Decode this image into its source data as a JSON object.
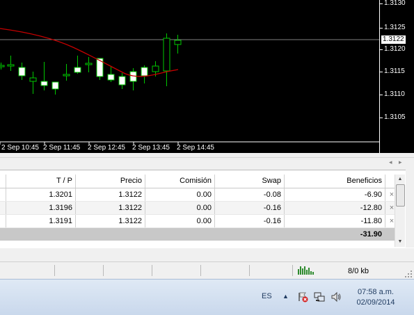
{
  "chart": {
    "price_labels": [
      "1.3130",
      "1.3125",
      "1.3120",
      "1.3115",
      "1.3110",
      "1.3105"
    ],
    "current_price": "1.3122",
    "time_labels": [
      "2 Sep 10:45",
      "2 Sep 11:45",
      "2 Sep 12:45",
      "2 Sep 13:45",
      "2 Sep 14:45"
    ],
    "colors": {
      "background": "#000000",
      "candle": "#00c800",
      "bull_body": "#ffffff",
      "ma_line": "#c80000",
      "price_line": "#808080"
    }
  },
  "terminal": {
    "headers": [
      "T / P",
      "Precio",
      "Comisión",
      "Swap",
      "Beneficios"
    ],
    "rows": [
      {
        "tp": "1.3201",
        "price": "1.3122",
        "commission": "0.00",
        "swap": "-0.08",
        "profit": "-6.90"
      },
      {
        "tp": "1.3196",
        "price": "1.3122",
        "commission": "0.00",
        "swap": "-0.16",
        "profit": "-12.80"
      },
      {
        "tp": "1.3191",
        "price": "1.3122",
        "commission": "0.00",
        "swap": "-0.16",
        "profit": "-11.80"
      }
    ],
    "total_profit": "-31.90",
    "close_glyph": "×"
  },
  "statusbar": {
    "connection": "8/0 kb"
  },
  "taskbar": {
    "language": "ES",
    "time": "07:58 a.m.",
    "date": "02/09/2014"
  }
}
